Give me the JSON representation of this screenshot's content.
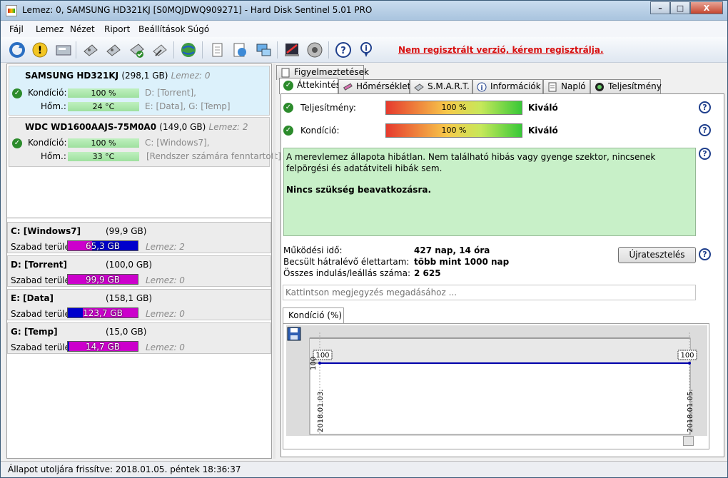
{
  "window": {
    "title": "Lemez: 0, SAMSUNG HD321KJ [S0MQJDWQ909271]  -  Hard Disk Sentinel 5.01 PRO",
    "controls": [
      "–",
      "□",
      "X"
    ]
  },
  "menu": [
    "Fájl",
    "Lemez",
    "Nézet",
    "Riport",
    "Beállítások",
    "Súgó"
  ],
  "toolbar": {
    "icons": [
      "refresh-icon",
      "alert-icon",
      "disk-icon",
      "disk-test-icon",
      "disk-test-icon",
      "disk-ok-icon",
      "disk-tool-icon",
      "web-icon",
      "report-icon",
      "sync-icon",
      "network-icon",
      "settings-icon",
      "sound-icon",
      "help-icon",
      "info-icon"
    ],
    "registration": "Nem regisztrált verzió, kérem regisztrálja."
  },
  "disks": [
    {
      "name": "SAMSUNG HD321KJ",
      "size": "(298,1 GB)",
      "lemez": "Lemez: 0",
      "kondicio_label": "Kondíció:",
      "kondicio": "100 %",
      "hom_label": "Hőm.:",
      "hom": "24 °C",
      "vol_line1": "D: [Torrent],",
      "vol_line2": "E: [Data], G: [Temp]"
    },
    {
      "name": "WDC WD1600AAJS-75M0A0",
      "size": "(149,0 GB)",
      "lemez": "Lemez: 2",
      "kondicio_label": "Kondíció:",
      "kondicio": "100 %",
      "hom_label": "Hőm.:",
      "hom": "33 °C",
      "vol_line1": "C: [Windows7],",
      "vol_line2": "[Rendszer számára fenntartott]"
    }
  ],
  "volumes": [
    {
      "name": "C: [Windows7]",
      "size": "(99,9 GB)",
      "free_label": "Szabad terület",
      "free": "65,3 GB",
      "free_fraction": 0.654,
      "color": "#0000cc",
      "lemez": "Lemez: 2"
    },
    {
      "name": "D: [Torrent]",
      "size": "(100,0 GB)",
      "free_label": "Szabad terület",
      "free": "99,9 GB",
      "free_fraction": 0.999,
      "color": "#cc00cc",
      "lemez": "Lemez: 0"
    },
    {
      "name": "E: [Data]",
      "size": "(158,1 GB)",
      "free_label": "Szabad terület",
      "free": "123,7 GB",
      "free_fraction": 0.782,
      "color": "#cc00cc",
      "lemez": "Lemez: 0"
    },
    {
      "name": "G: [Temp]",
      "size": "(15,0 GB)",
      "free_label": "Szabad terület",
      "free": "14,7 GB",
      "free_fraction": 0.98,
      "color": "#cc00cc",
      "lemez": "Lemez: 0"
    }
  ],
  "tabs_top": [
    "Figyelmeztetések"
  ],
  "tabs": [
    "Áttekintés",
    "Hőmérséklet",
    "S.M.A.R.T.",
    "Információk",
    "Napló",
    "Teljesítmény"
  ],
  "overview": {
    "perf_label": "Teljesítmény:",
    "perf_value": "100 %",
    "perf_rating": "Kiváló",
    "cond_label": "Kondíció:",
    "cond_value": "100 %",
    "cond_rating": "Kiváló",
    "status_text": "A merevlemez állapota hibátlan. Nem található hibás vagy gyenge szektor, nincsenek felpörgési és adatátviteli hibák sem.",
    "status_action": "Nincs szükség beavatkozásra.",
    "uptime_label": "Működési idő:",
    "uptime": "427 nap, 14 óra",
    "remaining_label": "Becsült hátralévő élettartam:",
    "remaining": "több mint 1000 nap",
    "starts_label": "Összes indulás/leállás száma:",
    "starts": "2 625",
    "retest_button": "Újratesztelés",
    "note_placeholder": "Kattintson megjegyzés megadásához ..."
  },
  "chart_tab": "Kondíció  (%)",
  "chart_data": {
    "type": "line",
    "x": [
      "2018.01.03.",
      "2018.01.05."
    ],
    "series": [
      {
        "values": [
          100,
          100
        ]
      }
    ],
    "ytick": "100",
    "point_labels": [
      "100",
      "100"
    ],
    "color": "#0000aa"
  },
  "status": "Állapot utoljára frissítve: 2018.01.05. péntek 18:36:37"
}
